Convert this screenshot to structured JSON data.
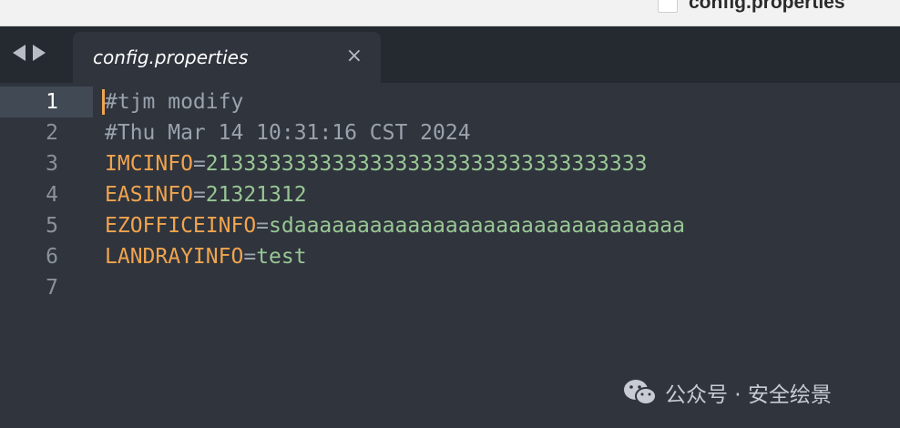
{
  "window": {
    "title": "config.properties"
  },
  "tabs": [
    {
      "label": "config.properties",
      "active": true,
      "close_glyph": "×"
    }
  ],
  "editor": {
    "current_line": 1,
    "lines": [
      {
        "num": "1",
        "comment": "#tjm modify"
      },
      {
        "num": "2",
        "comment": "#Thu Mar 14 10:31:16 CST 2024"
      },
      {
        "num": "3",
        "key": "IMCINFO",
        "eq": "=",
        "value": "21333333333333333333333333333333333"
      },
      {
        "num": "4",
        "key": "EASINFO",
        "eq": "=",
        "value": "21321312"
      },
      {
        "num": "5",
        "key": "EZOFFICEINFO",
        "eq": "=",
        "value": "sdaaaaaaaaaaaaaaaaaaaaaaaaaaaaaaa"
      },
      {
        "num": "6",
        "key": "LANDRAYINFO",
        "eq": "=",
        "value": "test"
      },
      {
        "num": "7"
      }
    ]
  },
  "watermark": {
    "text": "公众号 · 安全绘景",
    "icon": "wechat-icon"
  },
  "colors": {
    "background": "#2f343d",
    "tabbar": "#252a31",
    "comment": "#9aa2ad",
    "key": "#f0a44e",
    "value": "#99c794",
    "gutter": "#8b929c"
  }
}
